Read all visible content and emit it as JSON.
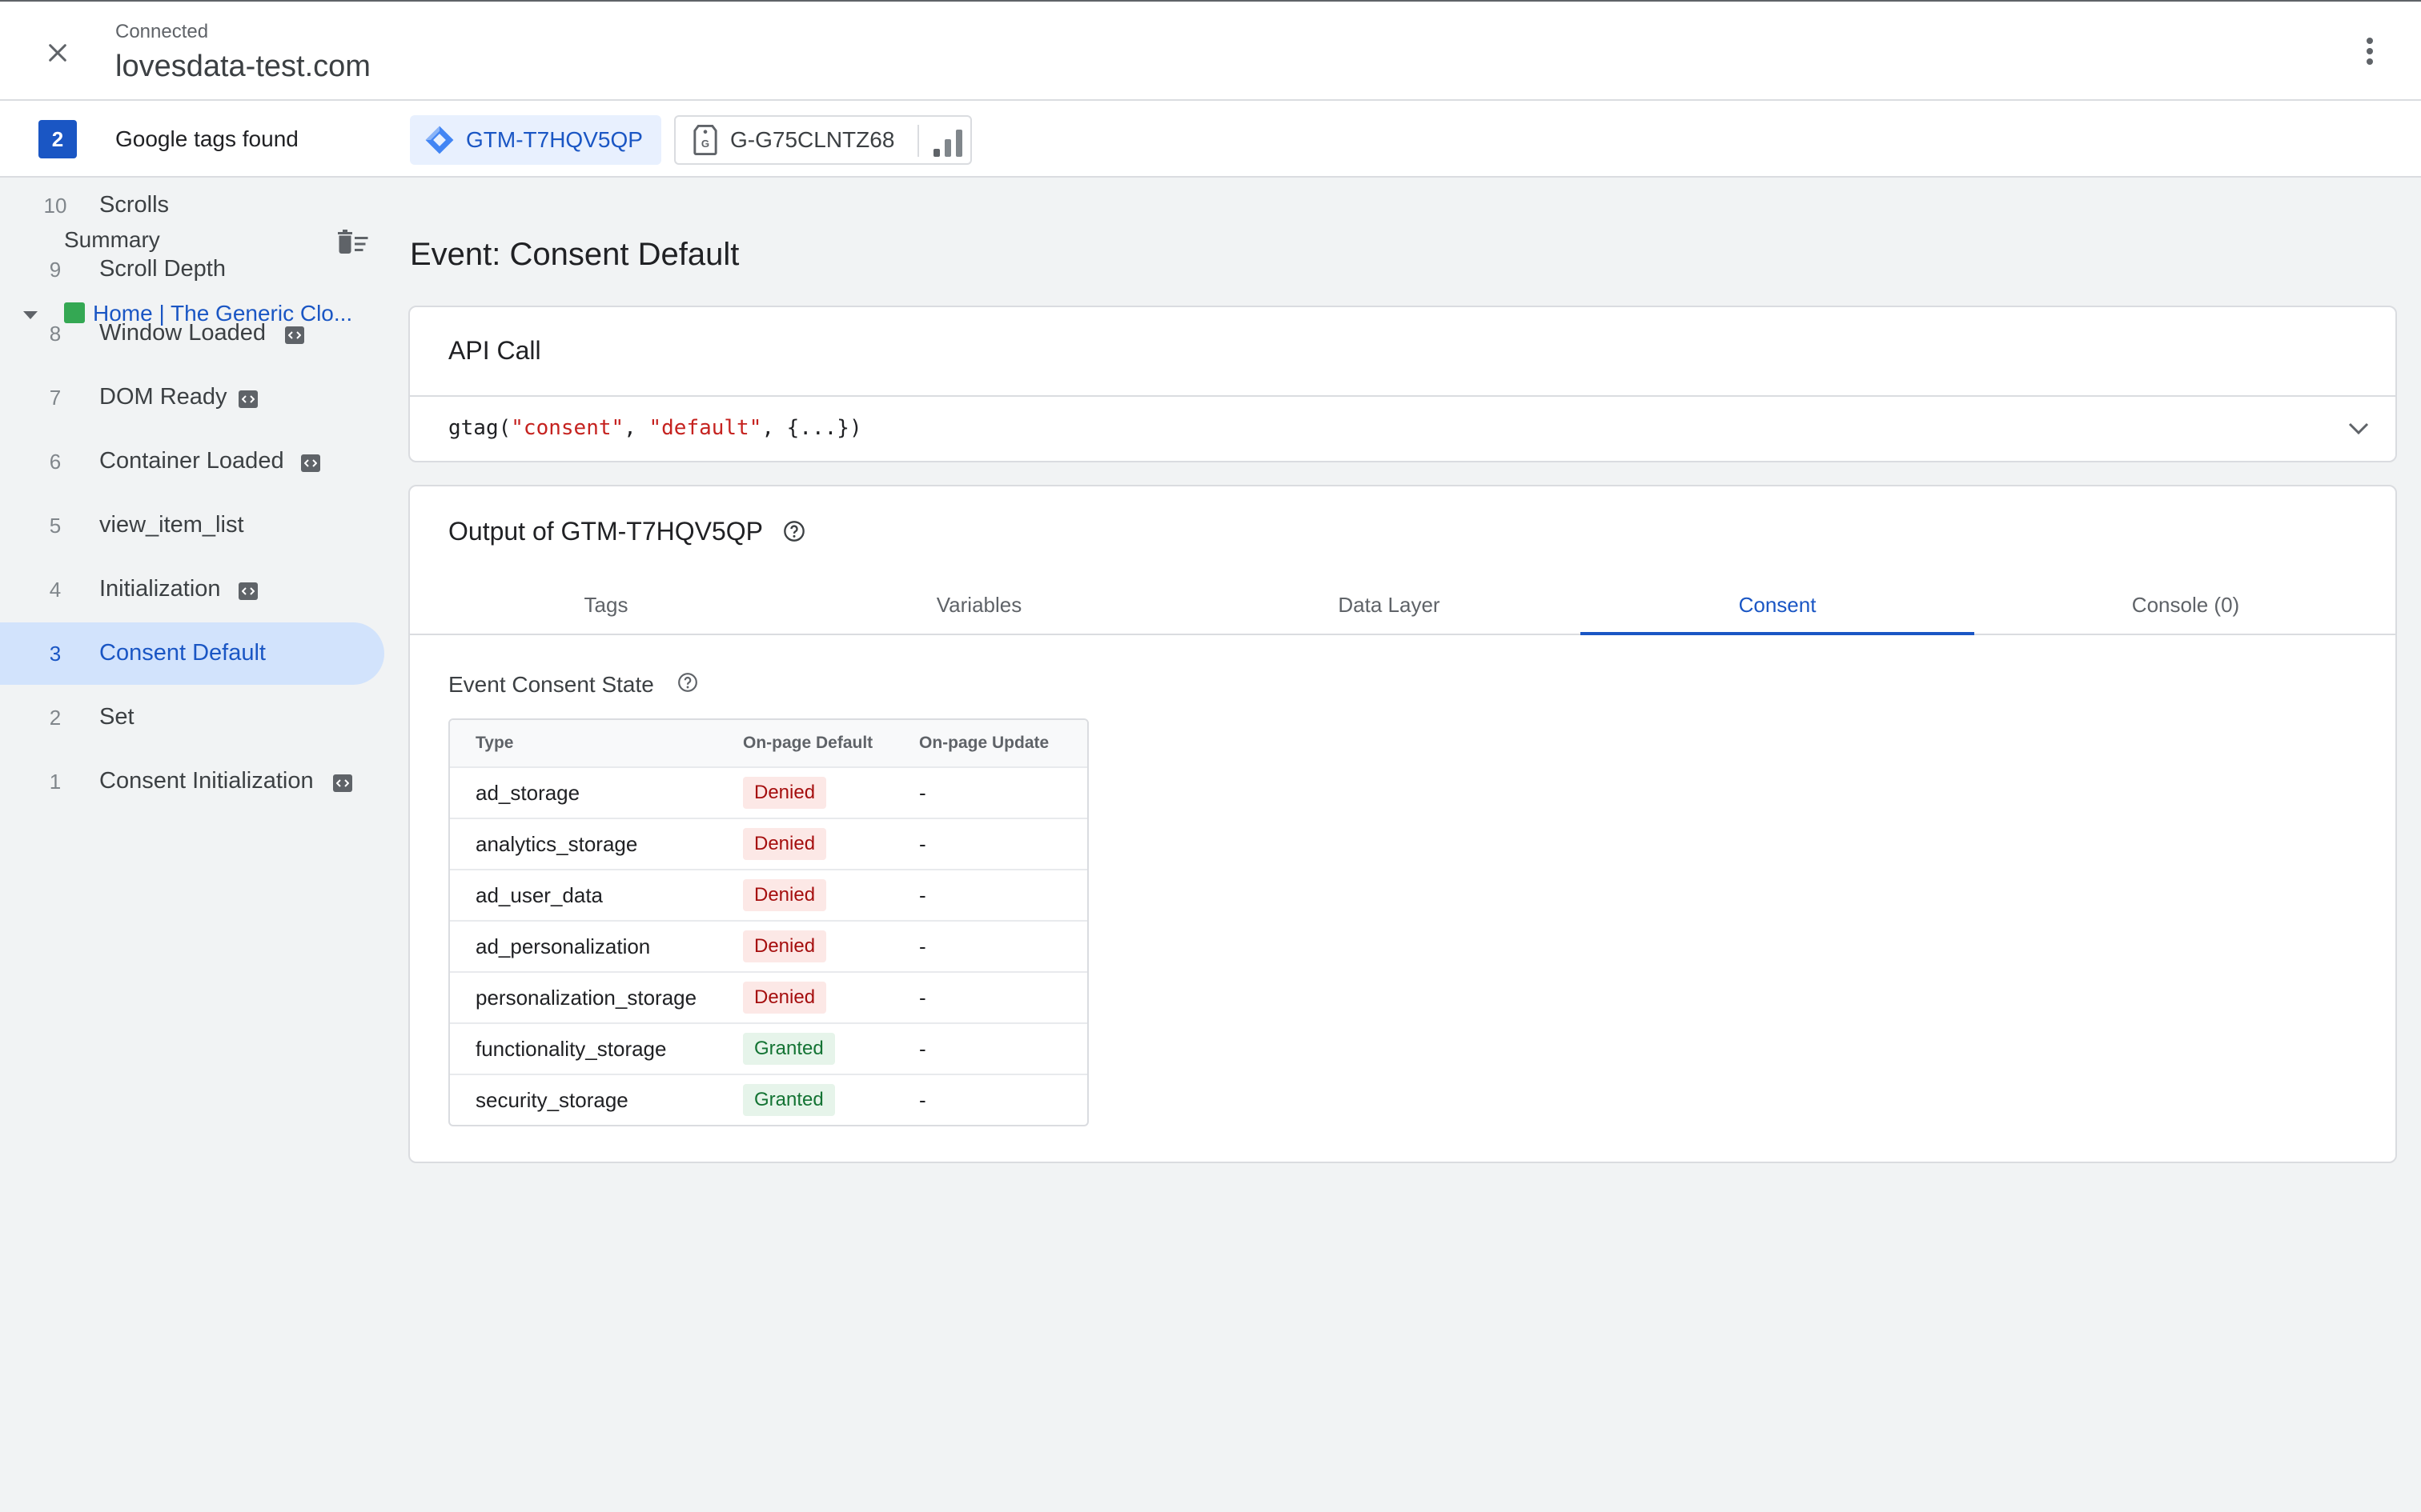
{
  "header": {
    "status": "Connected",
    "site": "lovesdata-test.com"
  },
  "tags_bar": {
    "count": "2",
    "label": "Google tags found",
    "gtm_id": "GTM-T7HQV5QP",
    "ga_id": "G-G75CLNTZ68"
  },
  "sidebar": {
    "summary": "Summary",
    "page": "Home | The Generic Clo...",
    "events": [
      {
        "num": "10",
        "label": "Scrolls",
        "code": false
      },
      {
        "num": "9",
        "label": "Scroll Depth",
        "code": false
      },
      {
        "num": "8",
        "label": "Window Loaded",
        "code": true
      },
      {
        "num": "7",
        "label": "DOM Ready",
        "code": true
      },
      {
        "num": "6",
        "label": "Container Loaded",
        "code": true
      },
      {
        "num": "5",
        "label": "view_item_list",
        "code": false
      },
      {
        "num": "4",
        "label": "Initialization",
        "code": true
      },
      {
        "num": "3",
        "label": "Consent Default",
        "code": false,
        "active": true
      },
      {
        "num": "2",
        "label": "Set",
        "code": false
      },
      {
        "num": "1",
        "label": "Consent Initialization",
        "code": true
      }
    ]
  },
  "main": {
    "event_title": "Event: Consent Default",
    "api_call": {
      "heading": "API Call",
      "fn": "gtag(",
      "arg1": "\"consent\"",
      "sep1": ", ",
      "arg2": "\"default\"",
      "rest": ", {...})"
    },
    "output": {
      "heading": "Output of GTM-T7HQV5QP",
      "tabs": [
        "Tags",
        "Variables",
        "Data Layer",
        "Consent",
        "Console (0)"
      ],
      "active_tab": "Consent",
      "consent_heading": "Event Consent State",
      "columns": [
        "Type",
        "On-page Default",
        "On-page Update"
      ],
      "rows": [
        {
          "type": "ad_storage",
          "default": "Denied",
          "update": "-"
        },
        {
          "type": "analytics_storage",
          "default": "Denied",
          "update": "-"
        },
        {
          "type": "ad_user_data",
          "default": "Denied",
          "update": "-"
        },
        {
          "type": "ad_personalization",
          "default": "Denied",
          "update": "-"
        },
        {
          "type": "personalization_storage",
          "default": "Denied",
          "update": "-"
        },
        {
          "type": "functionality_storage",
          "default": "Granted",
          "update": "-"
        },
        {
          "type": "security_storage",
          "default": "Granted",
          "update": "-"
        }
      ]
    }
  },
  "colors": {
    "accent": "#1a56c4",
    "denied_bg": "#fce8e6",
    "denied_fg": "#a50e0e",
    "granted_bg": "#e6f4ea",
    "granted_fg": "#137333"
  }
}
